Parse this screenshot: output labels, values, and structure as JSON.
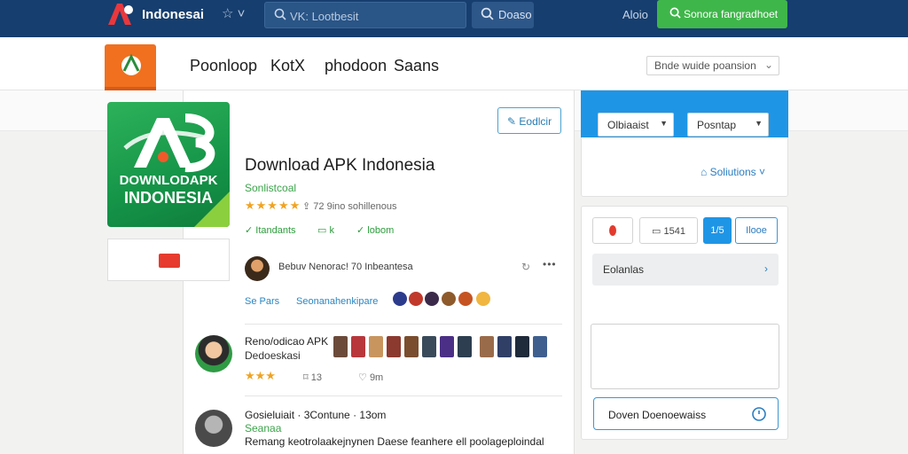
{
  "header": {
    "brand": "Indonesai",
    "star_menu": "☆ ˅",
    "search_placeholder": "VK: Lootbesit",
    "search_button": "Doaso",
    "about": "Aloio",
    "cta": "Sonora fangradhoet"
  },
  "subheader": {
    "nav": [
      "Poonloop",
      "KotX",
      "phodoon",
      "Saans"
    ],
    "sort_label": "Bnde wuide poansion"
  },
  "app": {
    "icon_line1": "DOWNLODAPK",
    "icon_line2": "INDONESIA",
    "edit_button": "Eodlcir",
    "title": "Download APK Indonesia",
    "subtitle": "Sonlistcoal",
    "stars": "★★★★★",
    "rating_text": "72 9ino sohillenous",
    "tags": [
      "Itandants",
      "k",
      "lobom"
    ],
    "owner_text": "Bebuv Nenorac! 70 Inbeantesa",
    "link_a": "Se Pars",
    "link_b": "Seonanahenkipare"
  },
  "reviews": [
    {
      "title": "Reno/odicao APK",
      "sub": "Dedoeskasi",
      "stars": "★★★",
      "replies": "13",
      "likes": "9m"
    },
    {
      "title": "Gosieluiait · 3Contune · 13om",
      "sub": "Seanaa",
      "body": "Remang keotrolaakejnynen Daese feanhere ell poolageploindal"
    }
  ],
  "right_panel": {
    "select1": "Olbiaaist",
    "select2": "Posntap",
    "solutions": "Soliutions",
    "btn_labels": [
      "",
      "1541",
      "1/5",
      "Ilooe"
    ],
    "list_item": "Eolanlas",
    "download_label": "Doven Doenoewaiss"
  },
  "colors": {
    "topbar": "#163e6e",
    "cta": "#3fb64a",
    "accent_blue": "#1f95e6",
    "brand_orange": "#f0701f",
    "green": "#2d9c3d"
  }
}
